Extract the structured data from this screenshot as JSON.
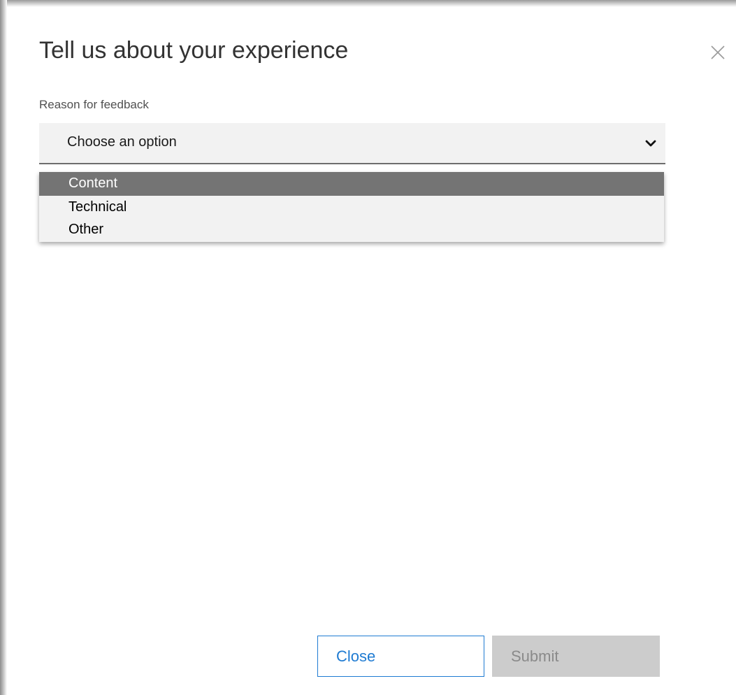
{
  "dialog": {
    "title": "Tell us about your experience",
    "close_icon": "close-icon"
  },
  "form": {
    "reason_label": "Reason for feedback",
    "select": {
      "value": "Choose an option",
      "chevron_icon": "chevron-down-icon"
    },
    "options": [
      {
        "label": "Content",
        "highlighted": true
      },
      {
        "label": "Technical",
        "highlighted": false
      },
      {
        "label": "Other",
        "highlighted": false
      }
    ]
  },
  "footer": {
    "close_label": "Close",
    "submit_label": "Submit",
    "submit_disabled": true
  },
  "colors": {
    "accent": "#1f7bd2",
    "option_highlight": "#747474",
    "select_background": "#f2f2f2",
    "disabled_button": "#cccccc"
  }
}
